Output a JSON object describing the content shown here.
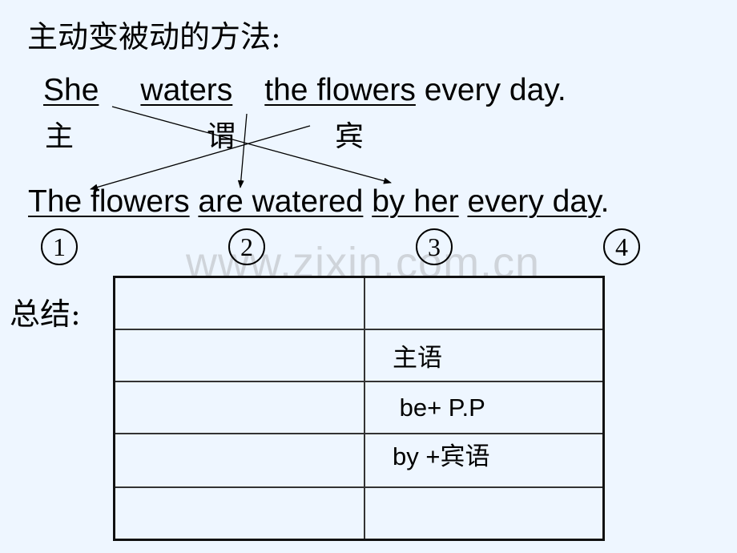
{
  "title": "主动变被动的方法:",
  "active_sentence": {
    "subject": "She",
    "verb": "waters",
    "object": "the flowers",
    "rest": "every day."
  },
  "role_labels": {
    "subject": "主",
    "verb": "谓",
    "object": "宾"
  },
  "passive_sentence": {
    "part1": "The flowers",
    "part2": "are watered",
    "part3": "by her",
    "part4": "every day",
    "end": "."
  },
  "numbers": [
    "①",
    "②",
    "③",
    "④"
  ],
  "number_digits": [
    "1",
    "2",
    "3",
    "4"
  ],
  "watermark": "www.zixin.com.cn",
  "summary_label": "总结:",
  "summary_table": {
    "rows": [
      [
        "",
        ""
      ],
      [
        "",
        "主语"
      ],
      [
        "",
        " be+ P.P"
      ],
      [
        "",
        "by +宾语"
      ],
      [
        "",
        ""
      ]
    ]
  }
}
